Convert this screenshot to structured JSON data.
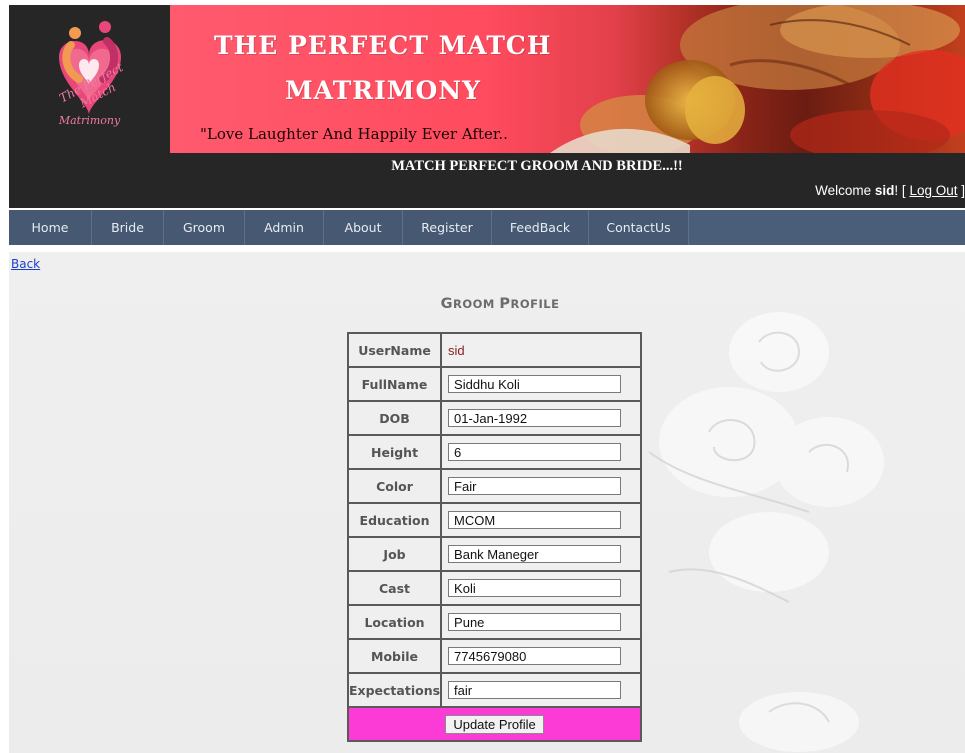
{
  "brand": {
    "logo_text_line1": "The Perfect Match",
    "logo_text_line2": "Matrimony",
    "banner_title_line1": "THE PERFECT MATCH",
    "banner_title_line2": "MATRIMONY",
    "banner_tagline": "\"Love Laughter  And Happily Ever After..",
    "header_tagline": "MATCH PERFECT GROOM AND BRIDE...!!"
  },
  "welcome": {
    "prefix": "Welcome ",
    "user": "sid",
    "suffix": "! [ ",
    "logout_label": "Log Out",
    "close": " ]"
  },
  "nav": {
    "items": [
      "Home",
      "Bride",
      "Groom",
      "Admin",
      "About",
      "Register",
      "FeedBack",
      "ContactUs"
    ]
  },
  "page": {
    "back_label": "Back",
    "title_first": "G",
    "title_rest": "ROOM ",
    "title_second": "P",
    "title_rest2": "ROFILE"
  },
  "profile": {
    "username_label": "UserName",
    "username_value": "sid",
    "fields": [
      {
        "label": "FullName",
        "value": "Siddhu Koli"
      },
      {
        "label": "DOB",
        "value": "01-Jan-1992"
      },
      {
        "label": "Height",
        "value": "6"
      },
      {
        "label": "Color",
        "value": "Fair"
      },
      {
        "label": "Education",
        "value": "MCOM"
      },
      {
        "label": "Job",
        "value": "Bank Maneger"
      },
      {
        "label": "Cast",
        "value": "Koli"
      },
      {
        "label": "Location",
        "value": "Pune"
      },
      {
        "label": "Mobile",
        "value": "7745679080"
      },
      {
        "label": "Expectations",
        "value": "fair"
      }
    ],
    "update_button": "Update Profile"
  },
  "colors": {
    "header_bg": "#262626",
    "nav_bg": "#465872",
    "banner_pink": "#ff5a6e",
    "action_row": "#fc3ad6",
    "link": "#1c3fcf"
  }
}
